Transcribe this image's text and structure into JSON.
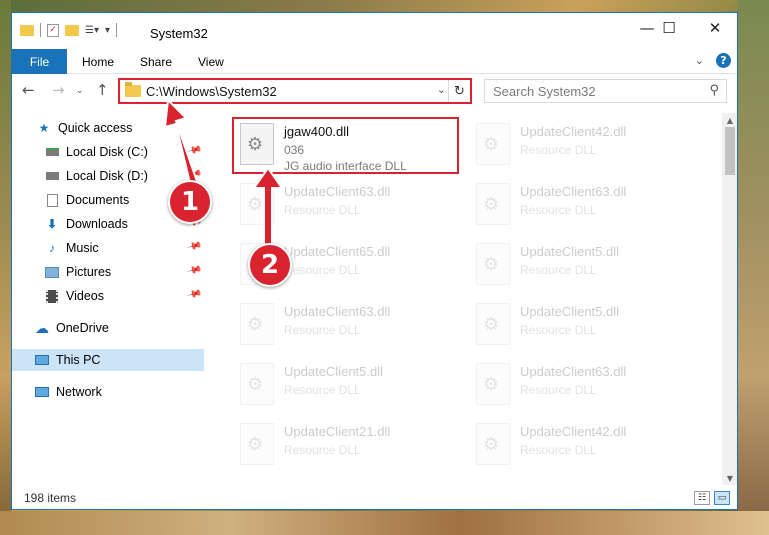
{
  "window": {
    "title": "System32"
  },
  "ribbon": {
    "file": "File",
    "home": "Home",
    "share": "Share",
    "view": "View"
  },
  "address": {
    "path": "C:\\Windows\\System32"
  },
  "search": {
    "placeholder": "Search System32"
  },
  "sidebar": {
    "items": [
      {
        "label": "Quick access",
        "icon": "star-icon"
      },
      {
        "label": "Local Disk (C:)",
        "icon": "drive-icon",
        "pinned": true
      },
      {
        "label": "Local Disk (D:)",
        "icon": "drive-icon",
        "pinned": true
      },
      {
        "label": "Documents",
        "icon": "documents-icon",
        "pinned": true
      },
      {
        "label": "Downloads",
        "icon": "download-icon",
        "pinned": true
      },
      {
        "label": "Music",
        "icon": "music-icon",
        "pinned": true
      },
      {
        "label": "Pictures",
        "icon": "pictures-icon",
        "pinned": true
      },
      {
        "label": "Videos",
        "icon": "videos-icon",
        "pinned": true
      },
      {
        "label": "OneDrive",
        "icon": "cloud-icon"
      },
      {
        "label": "This PC",
        "icon": "computer-icon",
        "selected": true
      },
      {
        "label": "Network",
        "icon": "network-icon"
      }
    ]
  },
  "files": {
    "highlighted": {
      "name": "jgaw400.dll",
      "version": "036",
      "description": "JG audio interface DLL"
    },
    "faded": [
      {
        "name": "UpdateClient42.dll",
        "type": "Resource DLL"
      },
      {
        "name": "UpdateClient63.dll",
        "type": "Resource DLL"
      },
      {
        "name": "UpdateClient63.dll",
        "type": "Resource DLL"
      },
      {
        "name": "UpdateClient65.dll",
        "type": "Resource DLL"
      },
      {
        "name": "UpdateClient5.dll",
        "type": "Resource DLL"
      },
      {
        "name": "UpdateClient63.dll",
        "type": "Resource DLL"
      },
      {
        "name": "UpdateClient5.dll",
        "type": "Resource DLL"
      },
      {
        "name": "UpdateClient5.dll",
        "type": "Resource DLL"
      },
      {
        "name": "UpdateClient63.dll",
        "type": "Resource DLL"
      },
      {
        "name": "UpdateClient21.dll",
        "type": "Resource DLL"
      },
      {
        "name": "UpdateClient42.dll",
        "type": "Resource DLL"
      }
    ]
  },
  "status": {
    "items": "198 items"
  },
  "annotations": {
    "step1": "1",
    "step2": "2"
  },
  "colors": {
    "accent": "#1a73b8",
    "highlight": "#d9232e",
    "selection": "#cce4f7"
  }
}
